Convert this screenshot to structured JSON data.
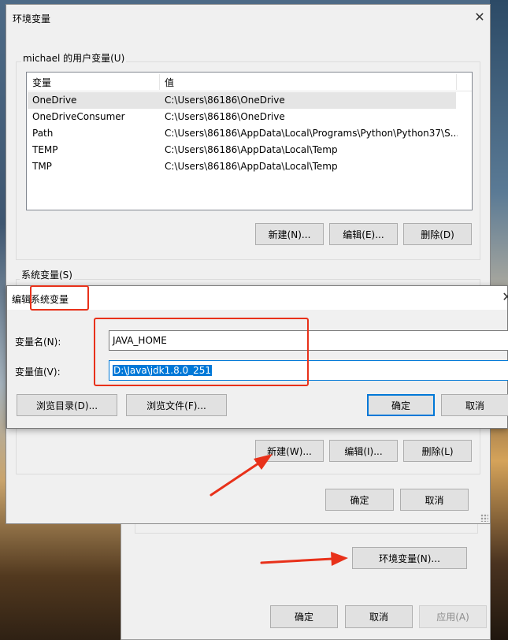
{
  "env_window": {
    "title": "环境变量",
    "user_group_label": "michael 的用户变量(U)",
    "list_headers": [
      "变量",
      "值"
    ],
    "user_vars": [
      {
        "name": "OneDrive",
        "value": "C:\\Users\\86186\\OneDrive"
      },
      {
        "name": "OneDriveConsumer",
        "value": "C:\\Users\\86186\\OneDrive"
      },
      {
        "name": "Path",
        "value": "C:\\Users\\86186\\AppData\\Local\\Programs\\Python\\Python37\\S..."
      },
      {
        "name": "TEMP",
        "value": "C:\\Users\\86186\\AppData\\Local\\Temp"
      },
      {
        "name": "TMP",
        "value": "C:\\Users\\86186\\AppData\\Local\\Temp"
      }
    ],
    "user_buttons": {
      "new": "新建(N)...",
      "edit": "编辑(E)...",
      "delete": "删除(D)"
    },
    "system_group_label": "系统变量(S)",
    "system_buttons": {
      "new": "新建(W)...",
      "edit": "编辑(I)...",
      "delete": "删除(L)"
    },
    "ok": "确定",
    "cancel": "取消"
  },
  "edit_dialog": {
    "title": "编辑系统变量",
    "name_label": "变量名(N):",
    "name_value": "JAVA_HOME",
    "value_label": "变量值(V):",
    "value_value": "D:\\Java\\jdk1.8.0_251",
    "browse_dir": "浏览目录(D)...",
    "browse_file": "浏览文件(F)...",
    "ok": "确定",
    "cancel": "取消"
  },
  "sys_props": {
    "env_button": "环境变量(N)...",
    "ok": "确定",
    "cancel": "取消",
    "apply": "应用(A)"
  },
  "colors": {
    "annotation_red": "#e8311a",
    "selection_blue": "#0078d7"
  }
}
